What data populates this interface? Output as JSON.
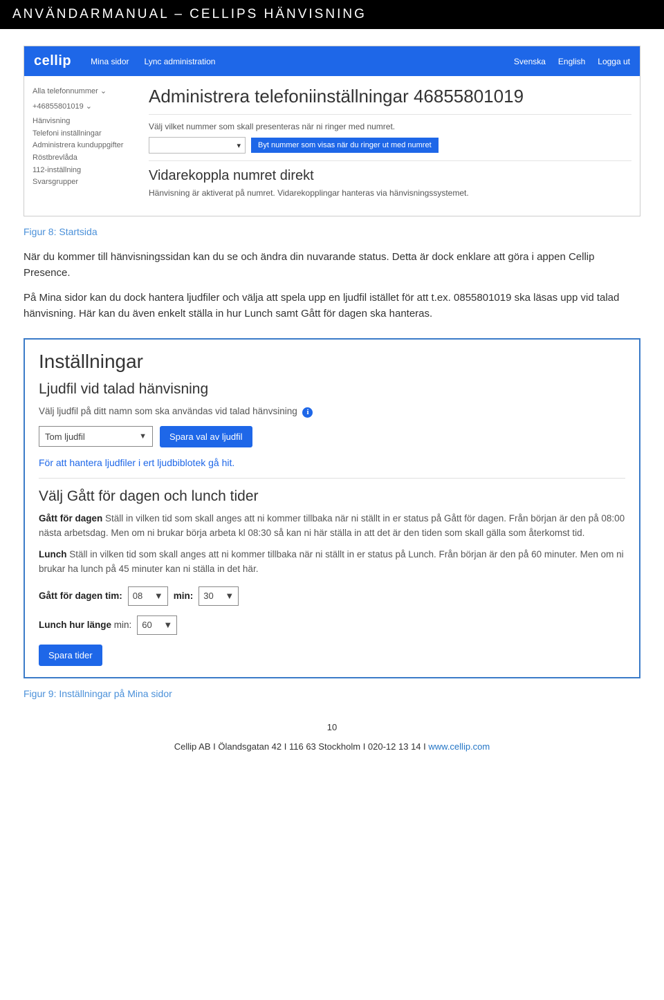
{
  "doc": {
    "header": "ANVÄNDARMANUAL – CELLIPS HÄNVISNING",
    "caption1": "Figur 8: Startsida",
    "para1": "När du kommer till hänvisningssidan kan du se och ändra din nuvarande status. Detta är dock enklare att göra i appen Cellip Presence.",
    "para2": "På Mina sidor kan du dock hantera ljudfiler och välja att spela upp en ljudfil istället för att t.ex. 0855801019 ska läsas upp vid talad hänvisning. Här kan du även enkelt ställa in hur Lunch samt Gått för dagen ska hanteras.",
    "caption2": "Figur 9: Inställningar på Mina sidor",
    "pageNum": "10",
    "footer_company": "Cellip AB  I  Ölandsgatan 42  I  116 63 Stockholm  I  020-12 13 14  I  ",
    "footer_url": "www.cellip.com"
  },
  "ss1": {
    "logo": "cellip",
    "nav_left": [
      "Mina sidor",
      "Lync administration"
    ],
    "nav_right": [
      "Svenska",
      "English",
      "Logga ut"
    ],
    "side_top": "Alla telefonnummer ⌄",
    "side_num": "+46855801019 ⌄",
    "side_items": [
      "Hänvisning",
      "Telefoni inställningar",
      "Administrera kunduppgifter",
      "Röstbrevlåda",
      "112-inställning",
      "Svarsgrupper"
    ],
    "h1": "Administrera telefoniinställningar 46855801019",
    "p1": "Välj vilket nummer som skall presenteras när ni ringer med numret.",
    "btn1": "Byt nummer som visas när du ringer ut med numret",
    "h2": "Vidarekoppla numret direkt",
    "p2": "Hänvisning är aktiverat på numret. Vidarekopplingar hanteras via hänvisningssystemet."
  },
  "ss2": {
    "h1": "Inställningar",
    "sec1_h": "Ljudfil vid talad hänvisning",
    "sec1_p": "Välj ljudfil på ditt namn som ska användas vid talad hänvsining",
    "sel1": "Tom ljudfil",
    "btn1": "Spara val av ljudfil",
    "link1": "För att hantera ljudfiler i ert ljudbiblotek gå hit.",
    "sec2_h": "Välj Gått för dagen och lunch tider",
    "sec2_p1a": "Gått för dagen",
    "sec2_p1b": " Ställ in vilken tid som skall anges att ni kommer tillbaka när ni ställt in er status på Gått för dagen. Från början är den på 08:00 nästa arbetsdag. Men om ni brukar börja arbeta kl 08:30 så kan ni här ställa in att det är den tiden som skall gälla som återkomst tid.",
    "sec2_p2a": "Lunch",
    "sec2_p2b": " Ställ in vilken tid som skall anges att ni kommer tillbaka när ni ställt in er status på Lunch. Från början är den på 60 minuter. Men om ni brukar ha lunch på 45 minuter kan ni ställa in det här.",
    "row1_label1": "Gått för dagen tim:",
    "row1_v1": "08",
    "row1_label2": "min:",
    "row1_v2": "30",
    "row2_label1": "Lunch hur länge",
    "row2_label2": " min:",
    "row2_v1": "60",
    "btn2": "Spara tider"
  }
}
